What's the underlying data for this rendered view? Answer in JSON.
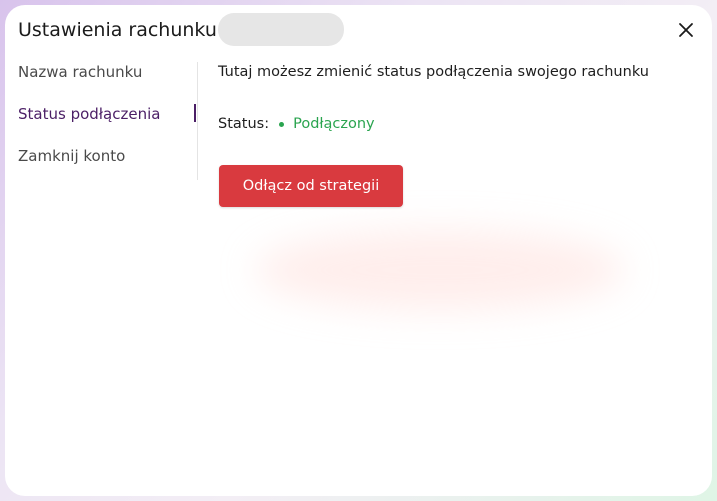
{
  "modal": {
    "title": "Ustawienia rachunku",
    "close_label": "close"
  },
  "nav": {
    "items": [
      {
        "label": "Nazwa rachunku",
        "active": false
      },
      {
        "label": "Status podłączenia",
        "active": true
      },
      {
        "label": "Zamknij konto",
        "active": false
      }
    ]
  },
  "content": {
    "description": "Tutaj możesz zmienić status podłączenia swojego rachunku",
    "status_label": "Status:",
    "status_value": "Podłączony",
    "disconnect_button": "Odłącz od strategii"
  },
  "colors": {
    "accent": "#4b1f66",
    "status_connected": "#2aa44f",
    "danger_button": "#d93a3f"
  },
  "icons": {
    "close": "close-icon",
    "status": "status-dot-icon"
  }
}
